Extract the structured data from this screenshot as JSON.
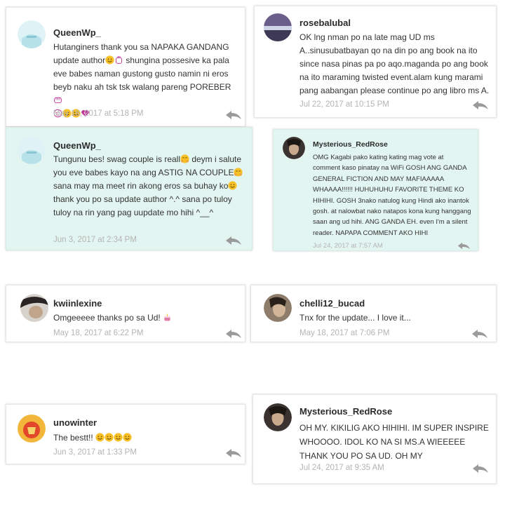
{
  "comments": [
    {
      "username": "QueenWp_",
      "text_before": "Hutanginers thank you sa NAPAKA GANDANG update author",
      "text_after": " shungina possesive ka pala eve babes naman gustong gusto namin ni eros beyb naku ah tsk tsk walang pareng POREBER",
      "timestamp": "May 18, 2017 at 5:18 PM"
    },
    {
      "username": "rosebalubal",
      "text": "OK lng nman po na late mag UD ms A..sinusubatbayan qo na din po ang book na ito since nasa pinas pa po aqo.maganda po ang book na ito maraming twisted event.alam kung marami pang aabangan please continue po ang libro ms A.",
      "timestamp": "Jul 22, 2017 at 10:15 PM"
    },
    {
      "username": "QueenWp_",
      "text_1": "Tungunu bes!  swag couple is reall",
      "text_2": " deym i salute you eve babes kayo na ang ASTIG NA COUPLE",
      "text_3": " sana may ma meet rin akong eros  sa buhay ko",
      "text_4": " thank you po sa update author ^.^ sana po tuloy tuloy na rin yang pag uupdate mo hihi ^__^",
      "timestamp": "Jun 3, 2017 at 2:34 PM"
    },
    {
      "username": "Mysterious_RedRose",
      "text": "OMG Kagabi pako kating kating mag vote at comment kaso pinatay na WiFi GOSH ANG GANDA GENERAL FICTION AND MAY MAFIAAAAA WHAAAA!!!!!! HUHUHUHU FAVORITE THEME KO HIHIHI. GOSH 3nako natulog kung Hindi ako inantok gosh. at nalowbat nako natapos kona kung hanggang saan ang ud hihi. ANG GANDA EH. even I'm a silent reader. NAPAPA COMMENT AKO HIHI",
      "timestamp": "Jul 24, 2017 at 7:57 AM"
    },
    {
      "username": "kwiinlexine",
      "text": "Omgeeeee thanks po sa Ud! ",
      "timestamp": "May 18, 2017 at 6:22 PM"
    },
    {
      "username": "chelli12_bucad",
      "text": "Tnx for the update... I love it...",
      "timestamp": "May 18, 2017 at 7:06 PM"
    },
    {
      "username": "unowinter",
      "text": "The bestt!! ",
      "timestamp": "Jun 3, 2017 at 1:33 PM"
    },
    {
      "username": "Mysterious_RedRose",
      "text": "OH MY. KIKILIG AKO HIHIHI. IM SUPER INSPIRE WHOOOO. IDOL KO NA SI MS.A WIEEEEE THANK YOU PO SA UD. OH MY",
      "timestamp": "Jul 24, 2017 at 9:35 AM"
    }
  ],
  "colors": {
    "highlight_bg": "#e3f5f1",
    "timestamp": "#b4b4b4",
    "reply_icon": "#9a9a9a",
    "emoji_yellow": "#f6c026"
  }
}
